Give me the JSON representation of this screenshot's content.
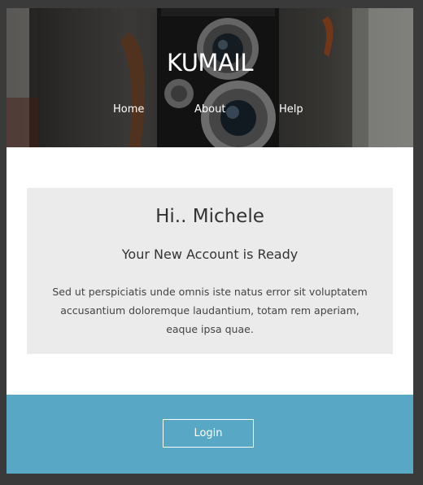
{
  "header": {
    "brand": "KUMAIL",
    "nav": [
      {
        "label": "Home"
      },
      {
        "label": "About"
      },
      {
        "label": "Help"
      }
    ]
  },
  "card": {
    "greeting": "Hi.. Michele",
    "subtitle": "Your New Account is Ready",
    "body": "Sed ut perspiciatis unde omnis iste natus error sit voluptatem accusantium doloremque laudantium, totam rem aperiam, eaque ipsa quae."
  },
  "footer": {
    "login_label": "Login"
  },
  "colors": {
    "page_bg": "#3a3a3a",
    "card_bg": "#ebebeb",
    "footer_bg": "#58a7c4",
    "text_dark": "#333333"
  }
}
